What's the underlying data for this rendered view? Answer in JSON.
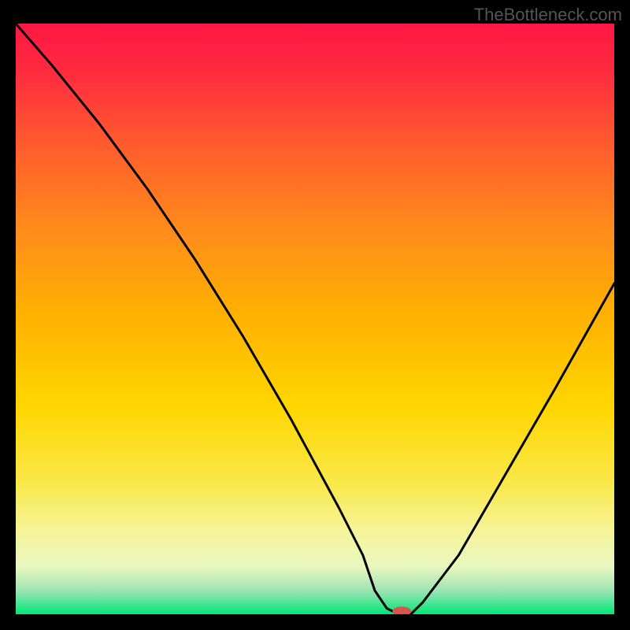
{
  "watermark": "TheBottleneck.com",
  "chart_data": {
    "type": "line",
    "title": "",
    "xlabel": "",
    "ylabel": "",
    "xlim": [
      0,
      100
    ],
    "ylim": [
      0,
      100
    ],
    "background_gradient": {
      "stops": [
        {
          "offset": 0.0,
          "color": "#ff1744"
        },
        {
          "offset": 0.08,
          "color": "#ff2a3f"
        },
        {
          "offset": 0.2,
          "color": "#ff5a2e"
        },
        {
          "offset": 0.35,
          "color": "#ff8c1a"
        },
        {
          "offset": 0.5,
          "color": "#ffb300"
        },
        {
          "offset": 0.65,
          "color": "#ffd600"
        },
        {
          "offset": 0.78,
          "color": "#f9e84a"
        },
        {
          "offset": 0.86,
          "color": "#f6f49a"
        },
        {
          "offset": 0.92,
          "color": "#e8f7c0"
        },
        {
          "offset": 0.96,
          "color": "#9de4b4"
        },
        {
          "offset": 1.0,
          "color": "#00e676"
        }
      ]
    },
    "series": [
      {
        "name": "bottleneck-curve",
        "x": [
          0,
          6,
          14,
          22,
          30,
          38,
          46,
          54,
          58,
          60,
          62,
          64,
          66,
          68,
          74,
          82,
          90,
          100
        ],
        "y": [
          100,
          93,
          83,
          72,
          60,
          47,
          33,
          18,
          10,
          4,
          1,
          0,
          0,
          2,
          10,
          24,
          38,
          56
        ]
      }
    ],
    "marker": {
      "name": "optimal-point",
      "x": 64.5,
      "y": 0.5,
      "color": "#d9534f",
      "rx": 12,
      "ry": 6
    }
  }
}
